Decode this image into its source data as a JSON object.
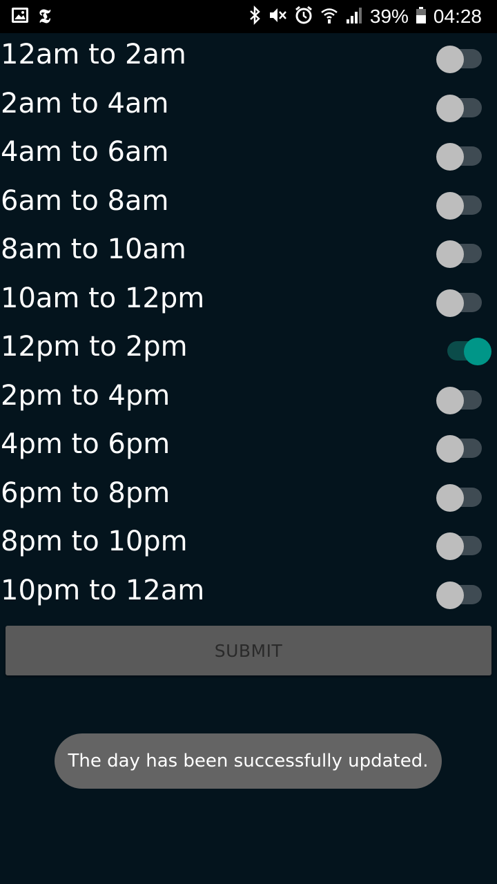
{
  "status_bar": {
    "battery_percent": "39%",
    "time": "04:28",
    "left_icons": [
      "gallery-icon",
      "nyt-icon"
    ],
    "right_icons": [
      "bluetooth-icon",
      "mute-icon",
      "alarm-icon",
      "wifi-icon",
      "signal-icon",
      "battery-icon"
    ],
    "nyt_glyph": "𝕿"
  },
  "slots": [
    {
      "label": "12am to 2am",
      "enabled": false
    },
    {
      "label": "2am to 4am",
      "enabled": false
    },
    {
      "label": "4am to 6am",
      "enabled": false
    },
    {
      "label": "6am to 8am",
      "enabled": false
    },
    {
      "label": "8am to 10am",
      "enabled": false
    },
    {
      "label": "10am to 12pm",
      "enabled": false
    },
    {
      "label": "12pm to 2pm",
      "enabled": true
    },
    {
      "label": "2pm to 4pm",
      "enabled": false
    },
    {
      "label": "4pm to 6pm",
      "enabled": false
    },
    {
      "label": "6pm to 8pm",
      "enabled": false
    },
    {
      "label": "8pm to 10pm",
      "enabled": false
    },
    {
      "label": "10pm to 12am",
      "enabled": false
    }
  ],
  "submit_label": "SUBMIT",
  "toast_message": "The day has been successfully updated.",
  "colors": {
    "background": "#04141d",
    "accent": "#009688",
    "switch_off_thumb": "#bdbdbd",
    "button_disabled": "#5a5a5a",
    "toast": "#646464"
  }
}
